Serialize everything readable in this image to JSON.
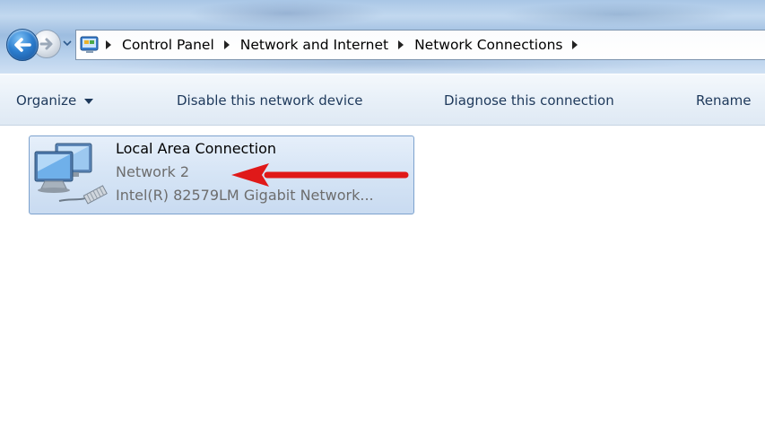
{
  "breadcrumb": {
    "items": [
      "Control Panel",
      "Network and Internet",
      "Network Connections"
    ]
  },
  "toolbar": {
    "organize_label": "Organize",
    "disable_label": "Disable this network device",
    "diagnose_label": "Diagnose this connection",
    "rename_label": "Rename"
  },
  "connection": {
    "name": "Local Area Connection",
    "network": "Network  2",
    "adapter": "Intel(R) 82579LM Gigabit Network..."
  },
  "icons": {
    "back": "back-arrow-icon",
    "forward": "forward-arrow-icon",
    "address": "control-panel-icon",
    "connection": "network-connection-icon",
    "annotation": "red-arrow-icon"
  },
  "colors": {
    "command_text": "#1e395b",
    "selection_bg": "#d5e4f5",
    "selection_border": "#7da2ce",
    "secondary_text": "#6d6d6d",
    "annotation_red": "#e01919"
  }
}
